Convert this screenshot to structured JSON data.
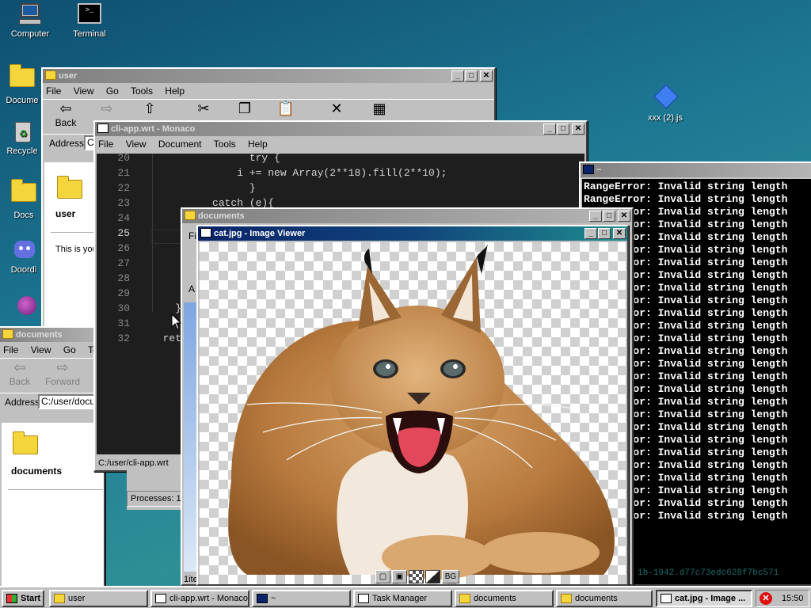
{
  "desktop": {
    "icons": [
      {
        "label": "Computer"
      },
      {
        "label": "Terminal"
      },
      {
        "label": "Docume"
      },
      {
        "label": "Recycle"
      },
      {
        "label": "Docs"
      },
      {
        "label": "Doordi"
      },
      {
        "label": "xxx (2).js"
      }
    ]
  },
  "user_window": {
    "title": "user",
    "menu": [
      "File",
      "View",
      "Go",
      "Tools",
      "Help"
    ],
    "toolbar": {
      "back": "Back"
    },
    "address_label": "Address",
    "address_value": "C",
    "folder_label": "user",
    "body_text": "This is you"
  },
  "monaco_window": {
    "title": "cli-app.wrt - Monaco",
    "menu": [
      "File",
      "View",
      "Document",
      "Tools",
      "Help"
    ],
    "lines": [
      {
        "n": "20",
        "code": "                try {"
      },
      {
        "n": "21",
        "code": "              i += new Array(2**18).fill(2**10);"
      },
      {
        "n": "22",
        "code": "                }"
      },
      {
        "n": "23",
        "code": "          catch (e){"
      },
      {
        "n": "24",
        "code": ""
      },
      {
        "n": "25",
        "code": ""
      },
      {
        "n": "26",
        "code": ""
      },
      {
        "n": "27",
        "code": ""
      },
      {
        "n": "28",
        "code": ""
      },
      {
        "n": "29",
        "code": ""
      },
      {
        "n": "30",
        "code": "    }"
      },
      {
        "n": "31",
        "code": ""
      },
      {
        "n": "32",
        "code": "  retur"
      }
    ],
    "status": "C:/user/cli-app.wrt"
  },
  "terminal_window": {
    "title": "~",
    "lines": [
      "RangeError: Invalid string length",
      "RangeError: Invalid string length",
      "RangeError: Invalid string length",
      "RangeError: Invalid string length",
      "RangeError: Invalid string length",
      "RangeError: Invalid string length",
      "RangeError: Invalid string length",
      "RangeError: Invalid string length",
      "RangeError: Invalid string length",
      "RangeError: Invalid string length",
      "RangeError: Invalid string length",
      "RangeError: Invalid string length",
      "RangeError: Invalid string length",
      "RangeError: Invalid string length",
      "RangeError: Invalid string length",
      "RangeError: Invalid string length",
      "RangeError: Invalid string length",
      "RangeError: Invalid string length",
      "RangeError: Invalid string length",
      "RangeError: Invalid string length",
      "RangeError: Invalid string length",
      "RangeError: Invalid string length",
      "RangeError: Invalid string length",
      "RangeError: Invalid string length",
      "RangeError: Invalid string length",
      "RangeError: Invalid string length",
      "RangeError: Invalid string length"
    ],
    "bottom_text": "1b-1942.d77c73edc628f7bc571"
  },
  "documents_window_small": {
    "title": "documents",
    "menu": [
      "File",
      "View",
      "Go",
      "Tools"
    ],
    "toolbar": {
      "back": "Back",
      "forward": "Forward"
    },
    "address_label": "Address",
    "address_value": "C:/user/docu",
    "folder_label": "documents"
  },
  "documents_window": {
    "title": "documents",
    "menu_first": "Fil",
    "address_first": "A",
    "status": "1ite"
  },
  "task_manager_window": {
    "status": "Processes: 1"
  },
  "image_viewer": {
    "title": "cat.jpg - Image Viewer",
    "controls": [
      "",
      "",
      "",
      "",
      "BG"
    ]
  },
  "taskbar": {
    "start": "Start",
    "tasks": [
      {
        "label": "user"
      },
      {
        "label": "cli-app.wrt - Monaco"
      },
      {
        "label": "~"
      },
      {
        "label": "Task Manager"
      },
      {
        "label": "documents"
      },
      {
        "label": "documents"
      },
      {
        "label": "cat.jpg - Image ..."
      }
    ],
    "clock": "15:50"
  },
  "colors": {
    "terminal_bg": "#000000",
    "terminal_fg": "#ffffff",
    "editor_bg": "#1e1e1e",
    "title_active": "#0a246a",
    "desktop": "#1d7893"
  }
}
